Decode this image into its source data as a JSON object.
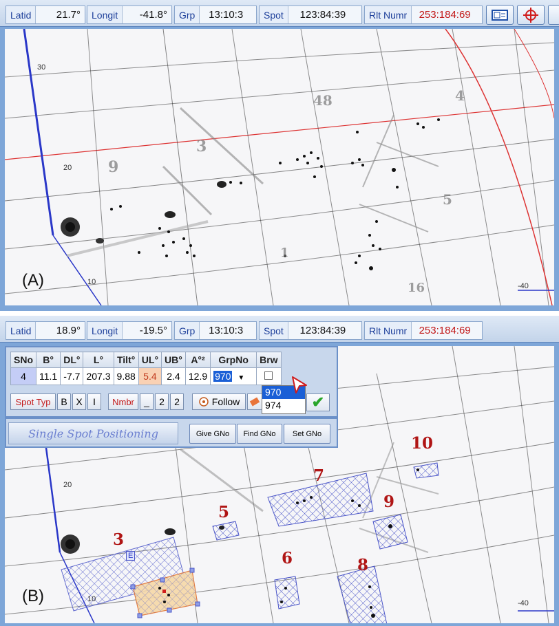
{
  "panel_a": {
    "panel_label": "(A)",
    "toolbar": {
      "latid_label": "Latid",
      "latid_value": "21.7°",
      "longit_label": "Longit",
      "longit_value": "-41.8°",
      "grp_label": "Grp",
      "grp_value": "13:10:3",
      "spot_label": "Spot",
      "spot_value": "123:84:39",
      "rlt_label": "Rlt Numr",
      "rlt_value": "253:184:69",
      "icons": [
        "window-icon",
        "crosshair-icon"
      ]
    },
    "ticks": {
      "lat_30": "30",
      "lat_20": "20",
      "lat_10": "10",
      "lon_m40": "-40"
    },
    "hand_numbers": [
      "9",
      "3",
      "48",
      "4",
      "5",
      "1",
      "16"
    ]
  },
  "panel_b": {
    "panel_label": "(B)",
    "toolbar": {
      "latid_label": "Latid",
      "latid_value": "18.9°",
      "longit_label": "Longit",
      "longit_value": "-19.5°",
      "grp_label": "Grp",
      "grp_value": "13:10:3",
      "spot_label": "Spot",
      "spot_value": "123:84:39",
      "rlt_label": "Rlt Numr",
      "rlt_value": "253:184:69"
    },
    "spot_table": {
      "headers": [
        "SNo",
        "B°",
        "DL°",
        "L°",
        "Tilt°",
        "UL°",
        "UB°",
        "A°²",
        "GrpNo",
        "Brw"
      ],
      "row": [
        "4",
        "11.1",
        "-7.7",
        "207.3",
        "9.88",
        "5.4",
        "2.4",
        "12.9",
        "970",
        ""
      ]
    },
    "controls": {
      "spot_typ_label": "Spot Typ",
      "b": "B",
      "x": "X",
      "i": "I",
      "nmbr_label": "Nmbr",
      "underscore": "_",
      "two_a": "2",
      "two_b": "2",
      "follow_label": "Follow"
    },
    "grpno_dropdown": {
      "selected": "970",
      "options": [
        "970",
        "974"
      ]
    },
    "bottom_bar": {
      "title": "Single Spot Positioning",
      "give_gno": "Give GNo",
      "find_gno": "Find GNo",
      "set_gno": "Set GNo"
    },
    "ticks": {
      "lat_20": "20",
      "lat_10": "10",
      "lon_m40": "-40"
    },
    "group_labels": [
      "3",
      "5",
      "6",
      "7",
      "8",
      "9",
      "10"
    ],
    "selected_marker": "E",
    "colors": {
      "group_label": "#b01515",
      "hatch": "#4a55c8",
      "selected_fill": "#f7d9a8"
    }
  }
}
